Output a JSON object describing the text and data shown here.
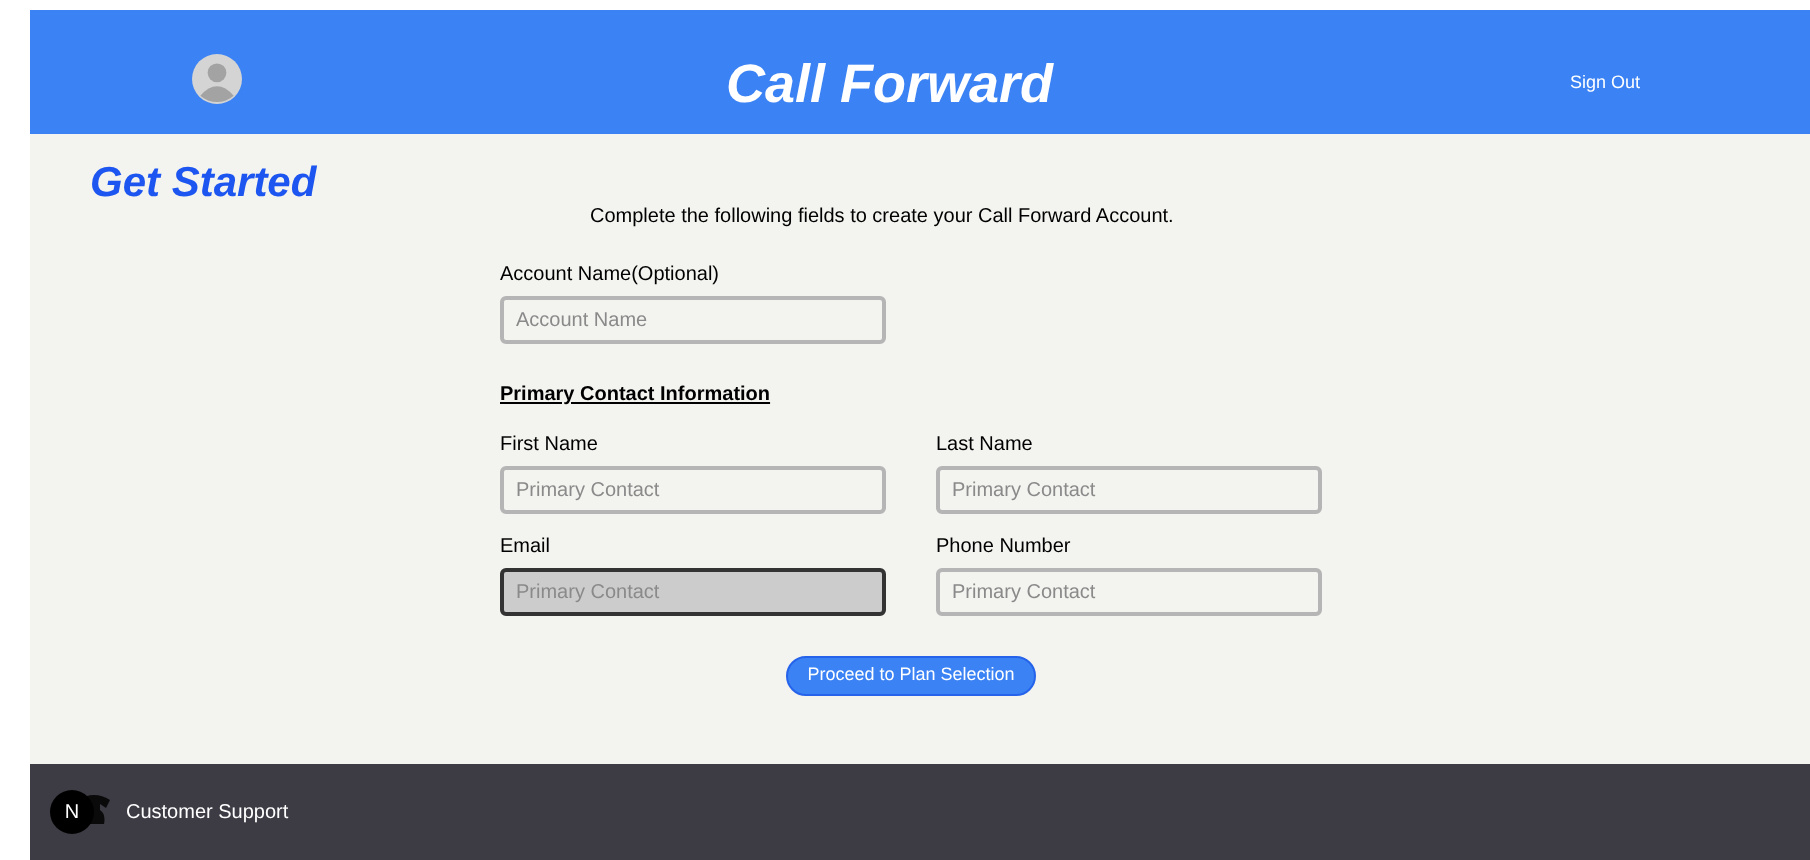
{
  "header": {
    "title": "Call Forward",
    "sign_out": "Sign Out"
  },
  "page": {
    "heading": "Get Started",
    "intro": "Complete the following fields to create your Call Forward Account."
  },
  "account": {
    "label": "Account Name(Optional)",
    "placeholder": "Account Name",
    "focused": false
  },
  "section_title": "Primary Contact Information",
  "fields": [
    {
      "label": "First Name",
      "placeholder": "Primary Contact",
      "focused": false
    },
    {
      "label": "Last Name",
      "placeholder": "Primary Contact",
      "focused": false
    },
    {
      "label": "Email",
      "placeholder": "Primary Contact",
      "focused": true
    },
    {
      "label": "Phone Number",
      "placeholder": "Primary Contact",
      "focused": false
    }
  ],
  "submit": "Proceed to Plan Selection",
  "footer": {
    "badge": "N",
    "link": "Customer Support"
  }
}
